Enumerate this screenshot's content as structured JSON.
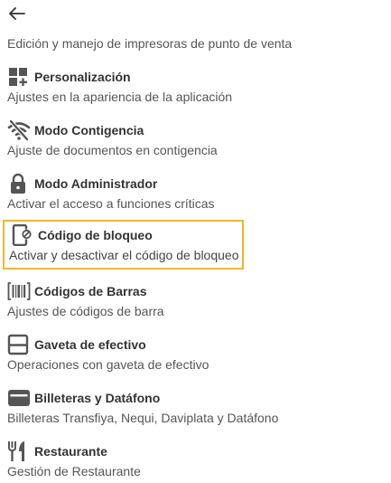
{
  "header": {
    "back_icon": "arrow-left-icon"
  },
  "intro_text": "Edición y manejo de impresoras de punto de venta",
  "highlight_color": "#f5b52a",
  "items": [
    {
      "icon": "layout-add-icon",
      "title": "Personalización",
      "desc": "Ajustes en la apariencia de la aplicación"
    },
    {
      "icon": "wifi-off-icon",
      "title": "Modo Contigencia",
      "desc": "Ajuste de documentos en contigencia"
    },
    {
      "icon": "lock-icon",
      "title": "Modo Administrador",
      "desc": "Activar el acceso a funciones críticas"
    },
    {
      "icon": "phone-lock-icon",
      "title": "Código de bloqueo",
      "desc": "Activar y desactivar el código de bloqueo",
      "selected": true
    },
    {
      "icon": "barcode-icon",
      "title": "Códigos de Barras",
      "desc": "Ajustes de códigos de barra"
    },
    {
      "icon": "cash-drawer-icon",
      "title": "Gaveta de efectivo",
      "desc": "Operaciones con gaveta de efectivo"
    },
    {
      "icon": "wallet-icon",
      "title": "Billeteras y Datáfono",
      "desc": "Billeteras Transfiya, Nequi, Daviplata y Datáfono"
    },
    {
      "icon": "restaurant-icon",
      "title": "Restaurante",
      "desc": "Gestión de Restaurante"
    }
  ]
}
